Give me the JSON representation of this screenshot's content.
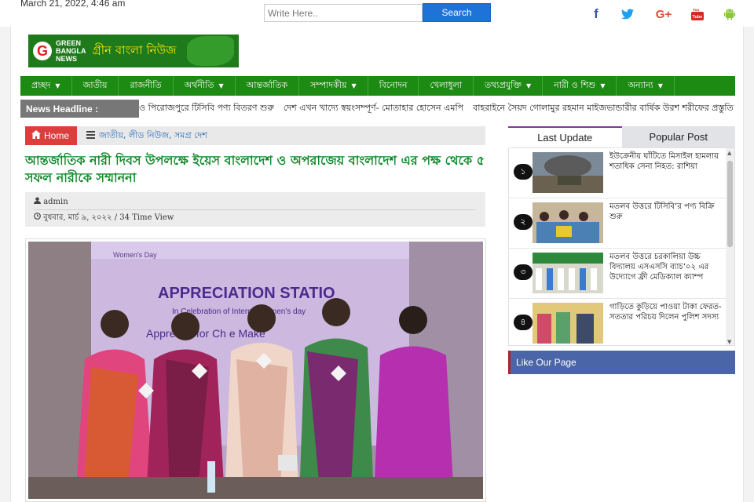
{
  "header": {
    "date": "March 21, 2022, 4:46 am",
    "search_placeholder": "Write Here..",
    "search_button": "Search",
    "social": [
      "facebook-icon",
      "twitter-icon",
      "google-plus-icon",
      "youtube-icon",
      "android-icon"
    ]
  },
  "logo": {
    "en_line1": "GREEN",
    "en_line2": "BANGLA",
    "en_line3": "NEWS",
    "bn": "গ্রীন বাংলা নিউজ"
  },
  "nav": [
    {
      "label": "প্রচ্ছদ",
      "dropdown": true
    },
    {
      "label": "জাতীয়",
      "dropdown": false
    },
    {
      "label": "রাজনীতি",
      "dropdown": false
    },
    {
      "label": "অর্থনীতি",
      "dropdown": true
    },
    {
      "label": "আন্তর্জাতিক",
      "dropdown": false
    },
    {
      "label": "সম্পাদকীয়",
      "dropdown": true
    },
    {
      "label": "বিনোদন",
      "dropdown": false
    },
    {
      "label": "খেলাধুলা",
      "dropdown": false
    },
    {
      "label": "তথ্যপ্রযুক্তি",
      "dropdown": true
    },
    {
      "label": "নারী ও শিশু",
      "dropdown": true
    },
    {
      "label": "অন্যান্য",
      "dropdown": true
    }
  ],
  "ticker": {
    "label": "News Headline :",
    "items": [
      "ও পিরোজপুরে টিসিবি পণ্য বিতরণ শুরু",
      "দেশ এখন খাদ্যে স্বয়ংসম্পূর্ণ- মোতাহার হোসেন এমপি",
      "বাহরাইনে সৈয়দ গোলামুর রহমান মাইজভান্ডারীর বার্ষিক উরশ শরীফের প্রস্তুতি সভা অ"
    ]
  },
  "breadcrumb": {
    "home": "Home",
    "categories": "জাতীয়, লীড নিউজ, সমগ্র দেশ"
  },
  "article": {
    "title": "আন্তর্জাতিক নারী দিবস উপলক্ষে ইয়েস বাংলাদেশ ও অপরাজেয় বাংলাদেশ এর পক্ষ থেকে ৫ সফল নারীকে সম্মাননা",
    "author": "admin",
    "date_views": "বুধবার, মার্চ ৯, ২০২২ / 34 Time View",
    "image": {
      "banner_main": "APPRECIATION STATIO",
      "banner_sub": "In Celebration of Interna         Women's day",
      "banner_line3": "Appre    ion for Ch     e Make",
      "banner_top": "Women's Day"
    }
  },
  "sidebar": {
    "tabs": [
      "Last Update",
      "Popular Post"
    ],
    "items": [
      {
        "num": "১",
        "title": "ইউক্রেনীয় ঘাঁটিতে মিসাইল হামলায় শতাধিক সেনা নিহত: রাশিয়া"
      },
      {
        "num": "২",
        "title": "মতলব উত্তরে টিসিবি’র পণ্য বিক্রি শুরু"
      },
      {
        "num": "৩",
        "title": "মতলব উত্তরে চরকালিয়া উচ্চ বিদ্যালয় এসএসসি ব্যাচ’০২ এর উদ্যোগে ফ্রী মেডিক্যাল ক্যাম্প"
      },
      {
        "num": "৪",
        "title": "গাড়িতে কুড়িয়ে পাওয়া টাকা ফেরত-সততার পরিচয় দিলেন পুলিশ সদস্য"
      }
    ],
    "like_box": "Like Our Page"
  },
  "colors": {
    "nav_green": "#1d8a13",
    "headline_green": "#128a2c",
    "home_red": "#dc3e3e",
    "search_blue": "#1e73d8",
    "like_blue": "#4a66a8"
  }
}
